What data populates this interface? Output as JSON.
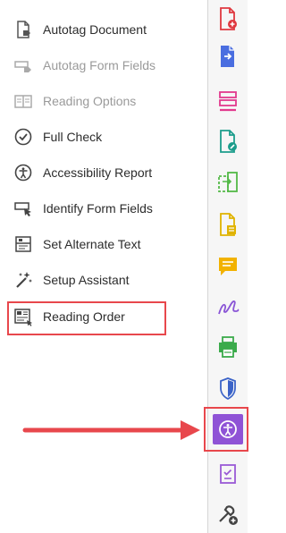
{
  "menu": {
    "items": [
      {
        "label": "Autotag Document",
        "icon": "autotag-document-icon",
        "disabled": false
      },
      {
        "label": "Autotag Form Fields",
        "icon": "autotag-form-fields-icon",
        "disabled": true
      },
      {
        "label": "Reading Options",
        "icon": "reading-options-icon",
        "disabled": true
      },
      {
        "label": "Full Check",
        "icon": "full-check-icon",
        "disabled": false
      },
      {
        "label": "Accessibility Report",
        "icon": "accessibility-report-icon",
        "disabled": false
      },
      {
        "label": "Identify Form Fields",
        "icon": "identify-form-fields-icon",
        "disabled": false
      },
      {
        "label": "Set Alternate Text",
        "icon": "set-alternate-text-icon",
        "disabled": false
      },
      {
        "label": "Setup Assistant",
        "icon": "setup-assistant-icon",
        "disabled": false
      },
      {
        "label": "Reading Order",
        "icon": "reading-order-icon",
        "disabled": false,
        "highlighted": true
      }
    ]
  },
  "toolbar": {
    "tools": [
      {
        "icon": "create-pdf-icon",
        "color": "#e0383f"
      },
      {
        "icon": "export-pdf-icon",
        "color": "#4a6ee0"
      },
      {
        "icon": "organize-pages-icon",
        "color": "#e23a8e"
      },
      {
        "icon": "edit-pdf-icon",
        "color": "#1c9d8c"
      },
      {
        "icon": "compare-files-icon",
        "color": "#54b948"
      },
      {
        "icon": "scan-ocr-icon",
        "color": "#e0b300"
      },
      {
        "icon": "comment-icon",
        "color": "#f2b200"
      },
      {
        "icon": "fill-sign-icon",
        "color": "#8a55d6"
      },
      {
        "icon": "print-production-icon",
        "color": "#3bab4b"
      },
      {
        "icon": "protect-icon",
        "color": "#3b63c8"
      },
      {
        "icon": "accessibility-icon",
        "color": "#8f53d6",
        "active": true
      },
      {
        "icon": "checklist-icon",
        "color": "#9a5ad6"
      },
      {
        "icon": "more-tools-icon",
        "color": "#444444"
      }
    ]
  },
  "colors": {
    "highlight": "#e8474c",
    "accent": "#8f53d6",
    "text": "#2c2c2c",
    "disabled_text": "#9a9a9a"
  }
}
